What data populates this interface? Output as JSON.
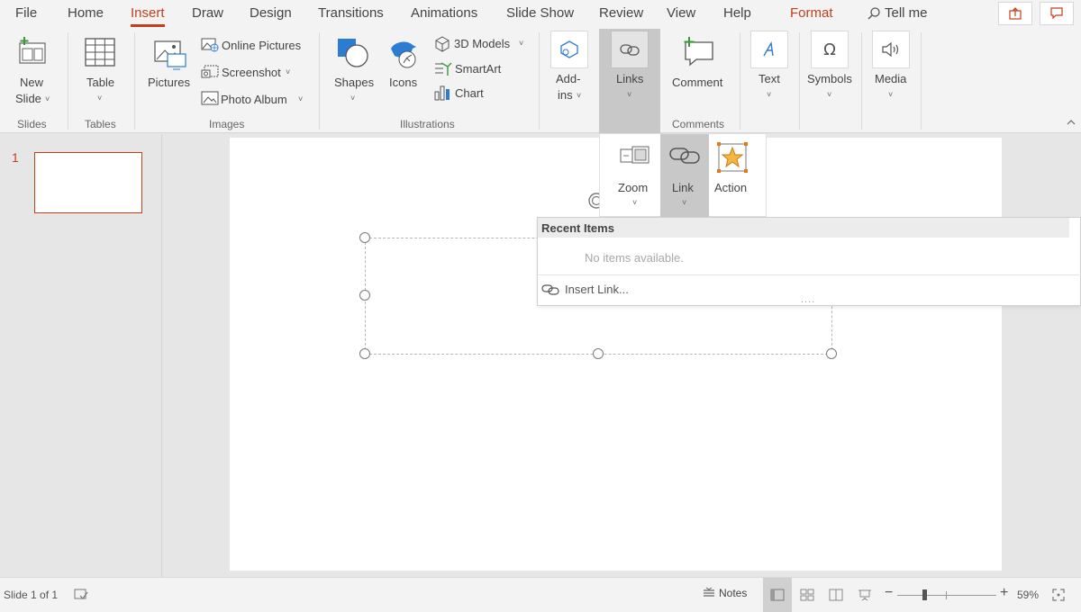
{
  "menu": {
    "tabs": [
      "File",
      "Home",
      "Insert",
      "Draw",
      "Design",
      "Transitions",
      "Animations",
      "Slide Show",
      "Review",
      "View",
      "Help"
    ],
    "active_tab": "Insert",
    "format": "Format",
    "tell_me": "Tell me"
  },
  "ribbon": {
    "slides": {
      "new_slide_line1": "New",
      "new_slide_line2": "Slide",
      "group": "Slides"
    },
    "tables": {
      "table": "Table",
      "group": "Tables"
    },
    "images": {
      "pictures": "Pictures",
      "online_pictures": "Online Pictures",
      "screenshot": "Screenshot",
      "photo_album": "Photo Album",
      "group": "Images"
    },
    "illustrations": {
      "shapes": "Shapes",
      "icons": "Icons",
      "models": "3D Models",
      "smartart": "SmartArt",
      "chart": "Chart",
      "group": "Illustrations"
    },
    "addins": {
      "line1": "Add-",
      "line2": "ins"
    },
    "links": {
      "label": "Links"
    },
    "comments": {
      "comment": "Comment",
      "group": "Comments"
    },
    "text": {
      "label": "Text"
    },
    "symbols": {
      "label": "Symbols"
    },
    "media": {
      "label": "Media"
    },
    "dropdown_glyph": "˅"
  },
  "links_menu": {
    "zoom": "Zoom",
    "link": "Link",
    "action": "Action",
    "recent_header": "Recent Items",
    "empty": "No items available.",
    "insert_link": "Insert Link...",
    "grip": "...."
  },
  "thumbnails": {
    "slide_number": "1"
  },
  "status": {
    "slide_info": "Slide 1 of 1",
    "notes": "Notes",
    "zoom_percent": "59%",
    "zoom_level": 0.59
  },
  "colors": {
    "accent": "#c43e1c",
    "selected": "#c8c8c8",
    "ribbon_bg": "#f3f3f3"
  }
}
